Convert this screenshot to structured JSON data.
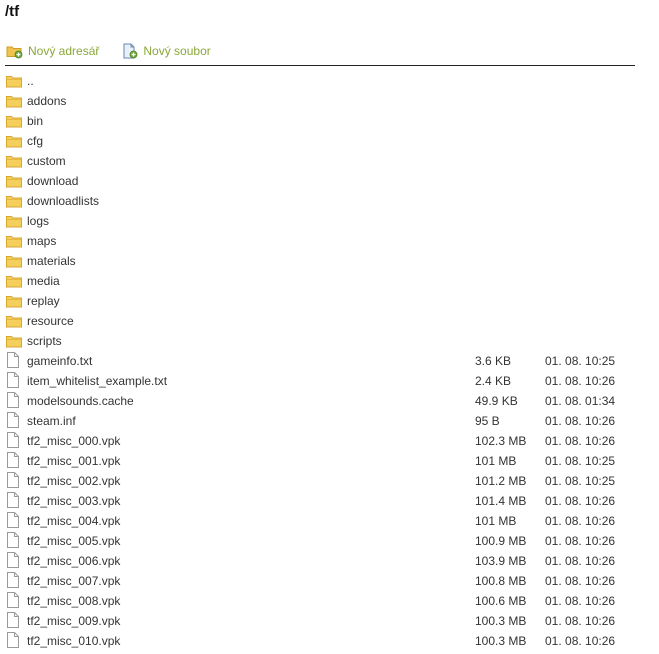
{
  "path_title": "/tf",
  "actions": {
    "new_folder": {
      "label": "Nový adresář",
      "icon": "folder-add-icon"
    },
    "new_file": {
      "label": "Nový soubor",
      "icon": "file-add-icon"
    }
  },
  "colors": {
    "action_link": "#8aa63a",
    "folder": "#f0c44a",
    "text": "#333333"
  },
  "folders": [
    {
      "name": "..",
      "icon": "folder-icon"
    },
    {
      "name": "addons",
      "icon": "folder-icon"
    },
    {
      "name": "bin",
      "icon": "folder-icon"
    },
    {
      "name": "cfg",
      "icon": "folder-icon"
    },
    {
      "name": "custom",
      "icon": "folder-icon"
    },
    {
      "name": "download",
      "icon": "folder-icon"
    },
    {
      "name": "downloadlists",
      "icon": "folder-icon"
    },
    {
      "name": "logs",
      "icon": "folder-icon"
    },
    {
      "name": "maps",
      "icon": "folder-icon"
    },
    {
      "name": "materials",
      "icon": "folder-icon"
    },
    {
      "name": "media",
      "icon": "folder-icon"
    },
    {
      "name": "replay",
      "icon": "folder-icon"
    },
    {
      "name": "resource",
      "icon": "folder-icon"
    },
    {
      "name": "scripts",
      "icon": "folder-icon"
    }
  ],
  "files": [
    {
      "name": "gameinfo.txt",
      "size": "3.6 KB",
      "date": "01. 08. 10:25",
      "icon": "file-icon"
    },
    {
      "name": "item_whitelist_example.txt",
      "size": "2.4 KB",
      "date": "01. 08. 10:26",
      "icon": "file-icon"
    },
    {
      "name": "modelsounds.cache",
      "size": "49.9 KB",
      "date": "01. 08. 01:34",
      "icon": "file-icon"
    },
    {
      "name": "steam.inf",
      "size": "95 B",
      "date": "01. 08. 10:26",
      "icon": "file-icon"
    },
    {
      "name": "tf2_misc_000.vpk",
      "size": "102.3 MB",
      "date": "01. 08. 10:26",
      "icon": "file-icon"
    },
    {
      "name": "tf2_misc_001.vpk",
      "size": "101 MB",
      "date": "01. 08. 10:25",
      "icon": "file-icon"
    },
    {
      "name": "tf2_misc_002.vpk",
      "size": "101.2 MB",
      "date": "01. 08. 10:25",
      "icon": "file-icon"
    },
    {
      "name": "tf2_misc_003.vpk",
      "size": "101.4 MB",
      "date": "01. 08. 10:26",
      "icon": "file-icon"
    },
    {
      "name": "tf2_misc_004.vpk",
      "size": "101 MB",
      "date": "01. 08. 10:26",
      "icon": "file-icon"
    },
    {
      "name": "tf2_misc_005.vpk",
      "size": "100.9 MB",
      "date": "01. 08. 10:26",
      "icon": "file-icon"
    },
    {
      "name": "tf2_misc_006.vpk",
      "size": "103.9 MB",
      "date": "01. 08. 10:26",
      "icon": "file-icon"
    },
    {
      "name": "tf2_misc_007.vpk",
      "size": "100.8 MB",
      "date": "01. 08. 10:26",
      "icon": "file-icon"
    },
    {
      "name": "tf2_misc_008.vpk",
      "size": "100.6 MB",
      "date": "01. 08. 10:26",
      "icon": "file-icon"
    },
    {
      "name": "tf2_misc_009.vpk",
      "size": "100.3 MB",
      "date": "01. 08. 10:26",
      "icon": "file-icon"
    },
    {
      "name": "tf2_misc_010.vpk",
      "size": "100.3 MB",
      "date": "01. 08. 10:26",
      "icon": "file-icon"
    }
  ]
}
